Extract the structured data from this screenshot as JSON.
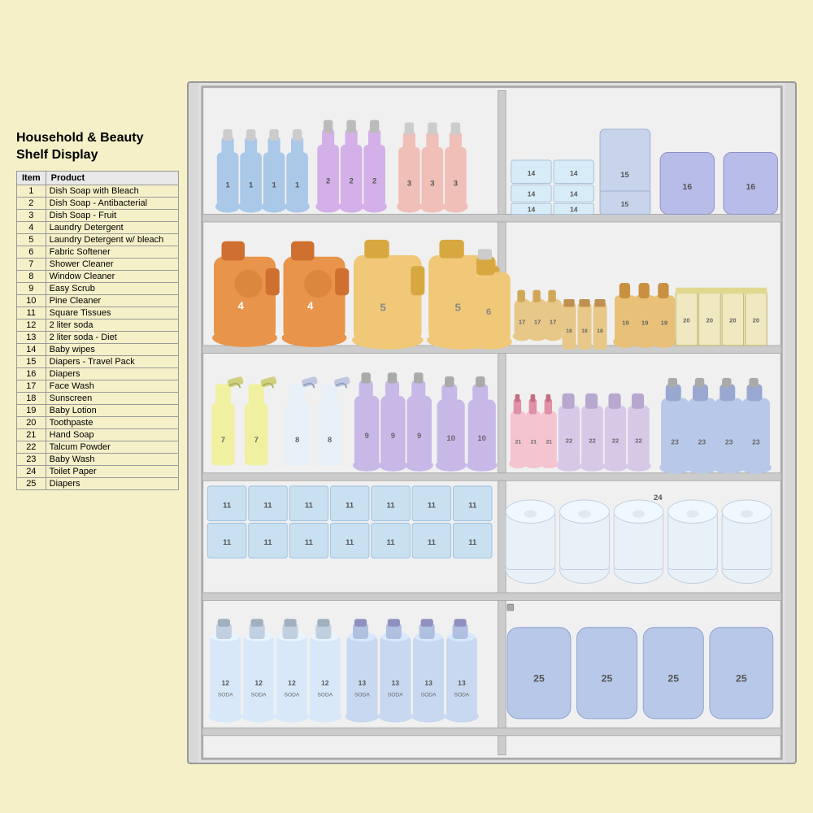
{
  "title": "Household & Beauty\nShelf Display",
  "legend": {
    "headers": [
      "Item",
      "Product"
    ],
    "rows": [
      [
        1,
        "Dish Soap with Bleach"
      ],
      [
        2,
        "Dish Soap - Antibacterial"
      ],
      [
        3,
        "Dish Soap - Fruit"
      ],
      [
        4,
        "Laundry Detergent"
      ],
      [
        5,
        "Laundry Detergent w/ bleach"
      ],
      [
        6,
        "Fabric Softener"
      ],
      [
        7,
        "Shower Cleaner"
      ],
      [
        8,
        "Window Cleaner"
      ],
      [
        9,
        "Easy Scrub"
      ],
      [
        10,
        "Pine Cleaner"
      ],
      [
        11,
        "Square Tissues"
      ],
      [
        12,
        "2 liter soda"
      ],
      [
        13,
        "2 liter soda - Diet"
      ],
      [
        14,
        "Baby wipes"
      ],
      [
        15,
        "Diapers - Travel Pack"
      ],
      [
        16,
        "Diapers"
      ],
      [
        17,
        "Face Wash"
      ],
      [
        18,
        "Sunscreen"
      ],
      [
        19,
        "Baby Lotion"
      ],
      [
        20,
        "Toothpaste"
      ],
      [
        21,
        "Hand Soap"
      ],
      [
        22,
        "Talcum Powder"
      ],
      [
        23,
        "Baby Wash"
      ],
      [
        24,
        "Toilet Paper"
      ],
      [
        25,
        "Diapers"
      ]
    ]
  }
}
